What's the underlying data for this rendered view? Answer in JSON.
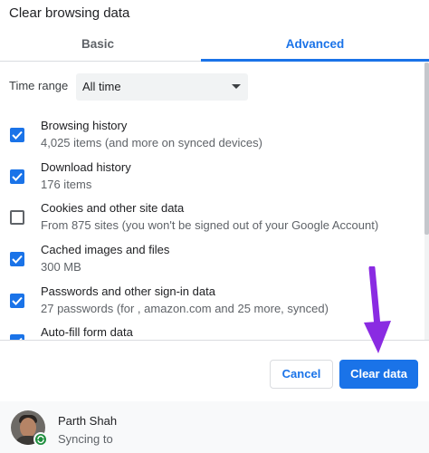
{
  "dialog": {
    "title": "Clear browsing data"
  },
  "tabs": [
    {
      "label": "Basic",
      "selected": false
    },
    {
      "label": "Advanced",
      "selected": true
    }
  ],
  "time_range": {
    "label": "Time range",
    "value": "All time"
  },
  "items": [
    {
      "title": "Browsing history",
      "subtitle": "4,025 items (and more on synced devices)",
      "checked": true
    },
    {
      "title": "Download history",
      "subtitle": "176 items",
      "checked": true
    },
    {
      "title": "Cookies and other site data",
      "subtitle": "From 875 sites (you won't be signed out of your Google Account)",
      "checked": false
    },
    {
      "title": "Cached images and files",
      "subtitle": "300 MB",
      "checked": true
    },
    {
      "title": "Passwords and other sign-in data",
      "subtitle": "27 passwords (for , amazon.com and 25 more, synced)",
      "checked": true
    },
    {
      "title": "Auto-fill form data",
      "subtitle": "",
      "checked": true
    }
  ],
  "buttons": {
    "cancel": "Cancel",
    "clear": "Clear data"
  },
  "account": {
    "name": "Parth Shah",
    "status": "Syncing to"
  },
  "colors": {
    "accent": "#1a73e8",
    "annotation_arrow": "#8a2be2",
    "sync_badge": "#1e8e3e"
  }
}
